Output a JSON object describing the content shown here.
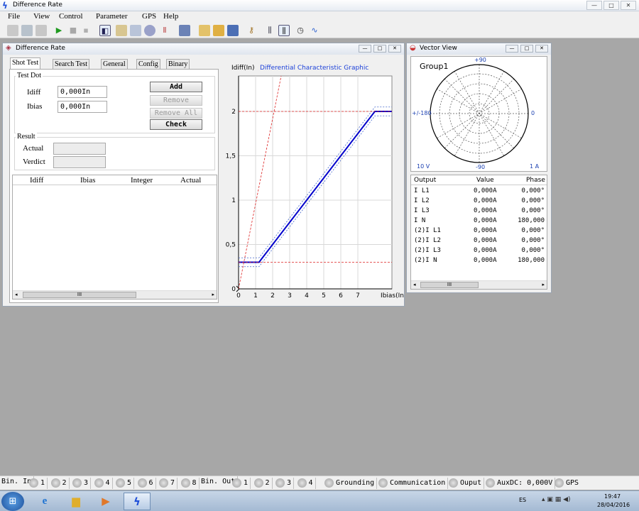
{
  "window": {
    "title": "Difference Rate"
  },
  "window_buttons": [
    "—",
    "□",
    "✕"
  ],
  "menu": [
    "File",
    "View",
    "Control",
    "Parameter",
    "GPS",
    "Help"
  ],
  "diff_panel": {
    "title": "Difference Rate",
    "tabs": [
      "Shot Test",
      "Search Test",
      "General",
      "Config",
      "Binary"
    ],
    "test_dot_label": "Test Dot",
    "idiff_label": "Idiff",
    "idiff_value": "0,000In",
    "ibias_label": "Ibias",
    "ibias_value": "0,000In",
    "buttons": {
      "add": "Add",
      "remove": "Remove",
      "remove_all": "Remove All",
      "check": "Check"
    },
    "result_label": "Result",
    "actual_label": "Actual",
    "verdict_label": "Verdict",
    "table_headers": [
      "Idiff",
      "Ibias",
      "Integer",
      "Actual"
    ],
    "scroll_thumb": "III"
  },
  "chart_data": {
    "type": "line",
    "title": "Differential Characteristic Graphic",
    "xlabel": "Ibias(In",
    "ylabel": "Idiff(In)",
    "xlim": [
      0,
      9
    ],
    "ylim": [
      0,
      2.4
    ],
    "x_ticks": [
      "0",
      "1",
      "2",
      "3",
      "4",
      "5",
      "6",
      "7"
    ],
    "y_ticks": [
      "0",
      "0,5",
      "1",
      "1,5",
      "2"
    ],
    "series": [
      {
        "role": "characteristic",
        "color": "#0000cc",
        "x": [
          0,
          1.2,
          8.0,
          9.2
        ],
        "y": [
          0.3,
          0.3,
          2.0,
          2.0
        ]
      },
      {
        "role": "upper tolerance",
        "color": "#4466cc",
        "x": [
          0,
          1.2,
          8.0,
          9.2
        ],
        "y": [
          0.35,
          0.35,
          2.05,
          2.05
        ]
      },
      {
        "role": "lower tolerance",
        "color": "#4466cc",
        "x": [
          0,
          1.2,
          8.0,
          9.2
        ],
        "y": [
          0.25,
          0.25,
          1.95,
          1.95
        ]
      },
      {
        "role": "reference line",
        "color": "#dd2222",
        "x": [
          0,
          2.5
        ],
        "y": [
          0,
          2.4
        ]
      },
      {
        "role": "Idiff limit high",
        "color": "#dd2222",
        "x": [
          0,
          9.2
        ],
        "y": [
          2.0,
          2.0
        ]
      },
      {
        "role": "Idiff limit low",
        "color": "#dd2222",
        "x": [
          0,
          9.2
        ],
        "y": [
          0.3,
          0.3
        ]
      }
    ],
    "grid": true
  },
  "vector_panel": {
    "title": "Vector View",
    "group": "Group1",
    "angle_top": "+90",
    "angle_bottom": "-90",
    "angle_left": "+/-180",
    "angle_right": "0",
    "voltage_scale": "10 V",
    "current_scale": "1 A",
    "table_headers": [
      "Output",
      "Value",
      "Phase"
    ],
    "rows": [
      {
        "output": "I L1",
        "value": "0,000A",
        "phase": "0,000°"
      },
      {
        "output": "I L2",
        "value": "0,000A",
        "phase": "0,000°"
      },
      {
        "output": "I L3",
        "value": "0,000A",
        "phase": "0,000°"
      },
      {
        "output": "I N",
        "value": "0,000A",
        "phase": "180,000"
      },
      {
        "output": "(2)I L1",
        "value": "0,000A",
        "phase": "0,000°"
      },
      {
        "output": "(2)I L2",
        "value": "0,000A",
        "phase": "0,000°"
      },
      {
        "output": "(2)I L3",
        "value": "0,000A",
        "phase": "0,000°"
      },
      {
        "output": "(2)I N",
        "value": "0,000A",
        "phase": "180,000"
      }
    ],
    "scroll_thumb": "III"
  },
  "statusbar": {
    "bin_in": "Bin. In",
    "bin_in_items": [
      "1",
      "2",
      "3",
      "4",
      "5",
      "6",
      "7",
      "8"
    ],
    "bin_out": "Bin. Out",
    "bin_out_items": [
      "1",
      "2",
      "3",
      "4"
    ],
    "grounding": "Grounding",
    "communication": "Communication",
    "output": "Ouput",
    "auxdc": "AuxDC: 0,000V",
    "gps": "GPS"
  },
  "taskbar": {
    "language": "ES",
    "time": "19:47",
    "date": "28/04/2016"
  }
}
